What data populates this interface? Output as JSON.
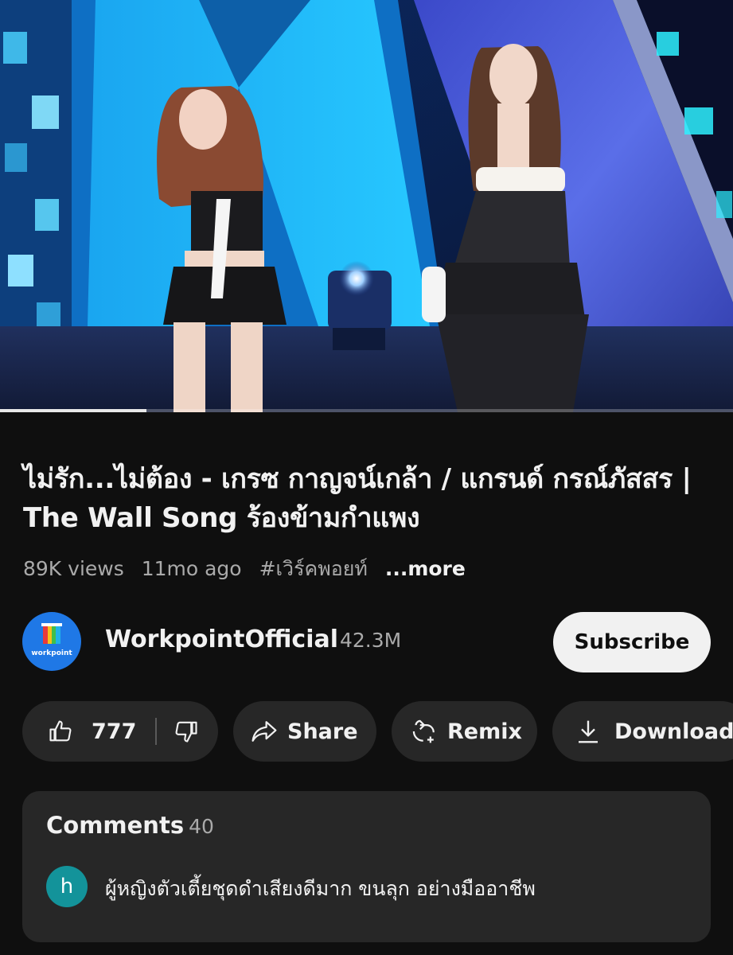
{
  "video": {
    "progress_fraction": 0.2,
    "title": "ไม่รัก...ไม่ต้อง - เกรซ กาญจน์เกล้า / แกรนด์ กรณ์ภัสสร | The Wall Song ร้องข้ามกำแพง",
    "views": "89K views",
    "age": "11mo ago",
    "hashtag": "#เวิร์คพอยท์",
    "more_label": "...more"
  },
  "channel": {
    "name": "WorkpointOfficial",
    "subscribers": "42.3M",
    "logo_text": "workpoint",
    "subscribe_label": "Subscribe"
  },
  "actions": {
    "like_count": "777",
    "share_label": "Share",
    "remix_label": "Remix",
    "download_label": "Download"
  },
  "comments": {
    "heading": "Comments",
    "count": "40",
    "top_comment": {
      "avatar_letter": "h",
      "text": "ผู้หญิงตัวเตี้ยชุดดำเสียงดีมาก ขนลุก อย่างมืออาชีพ"
    }
  },
  "colors": {
    "background": "#0f0f0f",
    "pill": "#272727",
    "subscribe_bg": "#f1f1f1",
    "commenter_avatar": "#13939a",
    "channel_avatar": "#1f78e6"
  }
}
